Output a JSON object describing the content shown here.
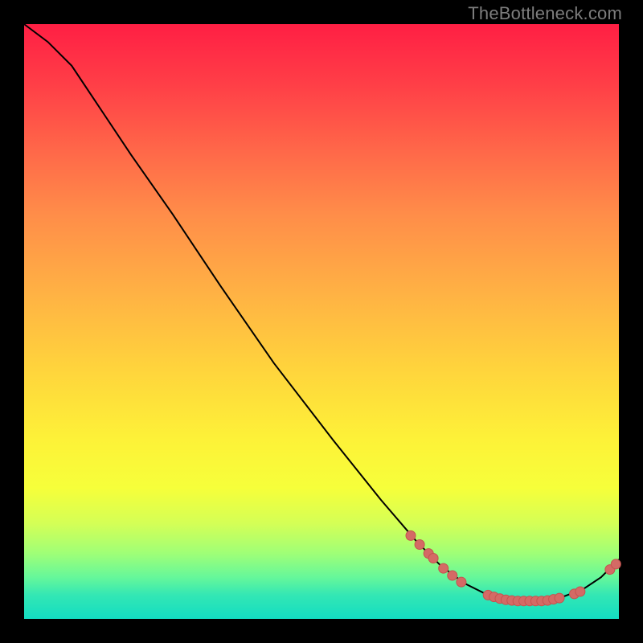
{
  "watermark": "TheBottleneck.com",
  "colors": {
    "curve_stroke": "#000000",
    "marker_fill": "#d46a65",
    "marker_stroke": "#c5534f"
  },
  "chart_data": {
    "type": "line",
    "title": "",
    "xlabel": "",
    "ylabel": "",
    "xlim": [
      0,
      100
    ],
    "ylim": [
      0,
      100
    ],
    "curve": [
      {
        "x": 0,
        "y": 100
      },
      {
        "x": 4,
        "y": 97
      },
      {
        "x": 8,
        "y": 93
      },
      {
        "x": 12,
        "y": 87
      },
      {
        "x": 18,
        "y": 78
      },
      {
        "x": 25,
        "y": 68
      },
      {
        "x": 33,
        "y": 56
      },
      {
        "x": 42,
        "y": 43
      },
      {
        "x": 52,
        "y": 30
      },
      {
        "x": 60,
        "y": 20
      },
      {
        "x": 66,
        "y": 13
      },
      {
        "x": 70,
        "y": 9
      },
      {
        "x": 74,
        "y": 6
      },
      {
        "x": 78,
        "y": 4
      },
      {
        "x": 82,
        "y": 3
      },
      {
        "x": 86,
        "y": 3
      },
      {
        "x": 90,
        "y": 3.5
      },
      {
        "x": 94,
        "y": 5
      },
      {
        "x": 97,
        "y": 7
      },
      {
        "x": 100,
        "y": 10
      }
    ],
    "markers": [
      {
        "x": 65,
        "y": 14
      },
      {
        "x": 66.5,
        "y": 12.5
      },
      {
        "x": 68,
        "y": 11
      },
      {
        "x": 68.8,
        "y": 10.2
      },
      {
        "x": 70.5,
        "y": 8.5
      },
      {
        "x": 72,
        "y": 7.3
      },
      {
        "x": 73.5,
        "y": 6.2
      },
      {
        "x": 78,
        "y": 4
      },
      {
        "x": 79,
        "y": 3.7
      },
      {
        "x": 80,
        "y": 3.4
      },
      {
        "x": 81,
        "y": 3.2
      },
      {
        "x": 82,
        "y": 3.1
      },
      {
        "x": 83,
        "y": 3.0
      },
      {
        "x": 84,
        "y": 3.0
      },
      {
        "x": 85,
        "y": 3.0
      },
      {
        "x": 86,
        "y": 3.0
      },
      {
        "x": 87,
        "y": 3.0
      },
      {
        "x": 88,
        "y": 3.1
      },
      {
        "x": 89,
        "y": 3.3
      },
      {
        "x": 90,
        "y": 3.5
      },
      {
        "x": 92.5,
        "y": 4.2
      },
      {
        "x": 93.5,
        "y": 4.6
      },
      {
        "x": 98.5,
        "y": 8.3
      },
      {
        "x": 99.5,
        "y": 9.2
      }
    ]
  }
}
